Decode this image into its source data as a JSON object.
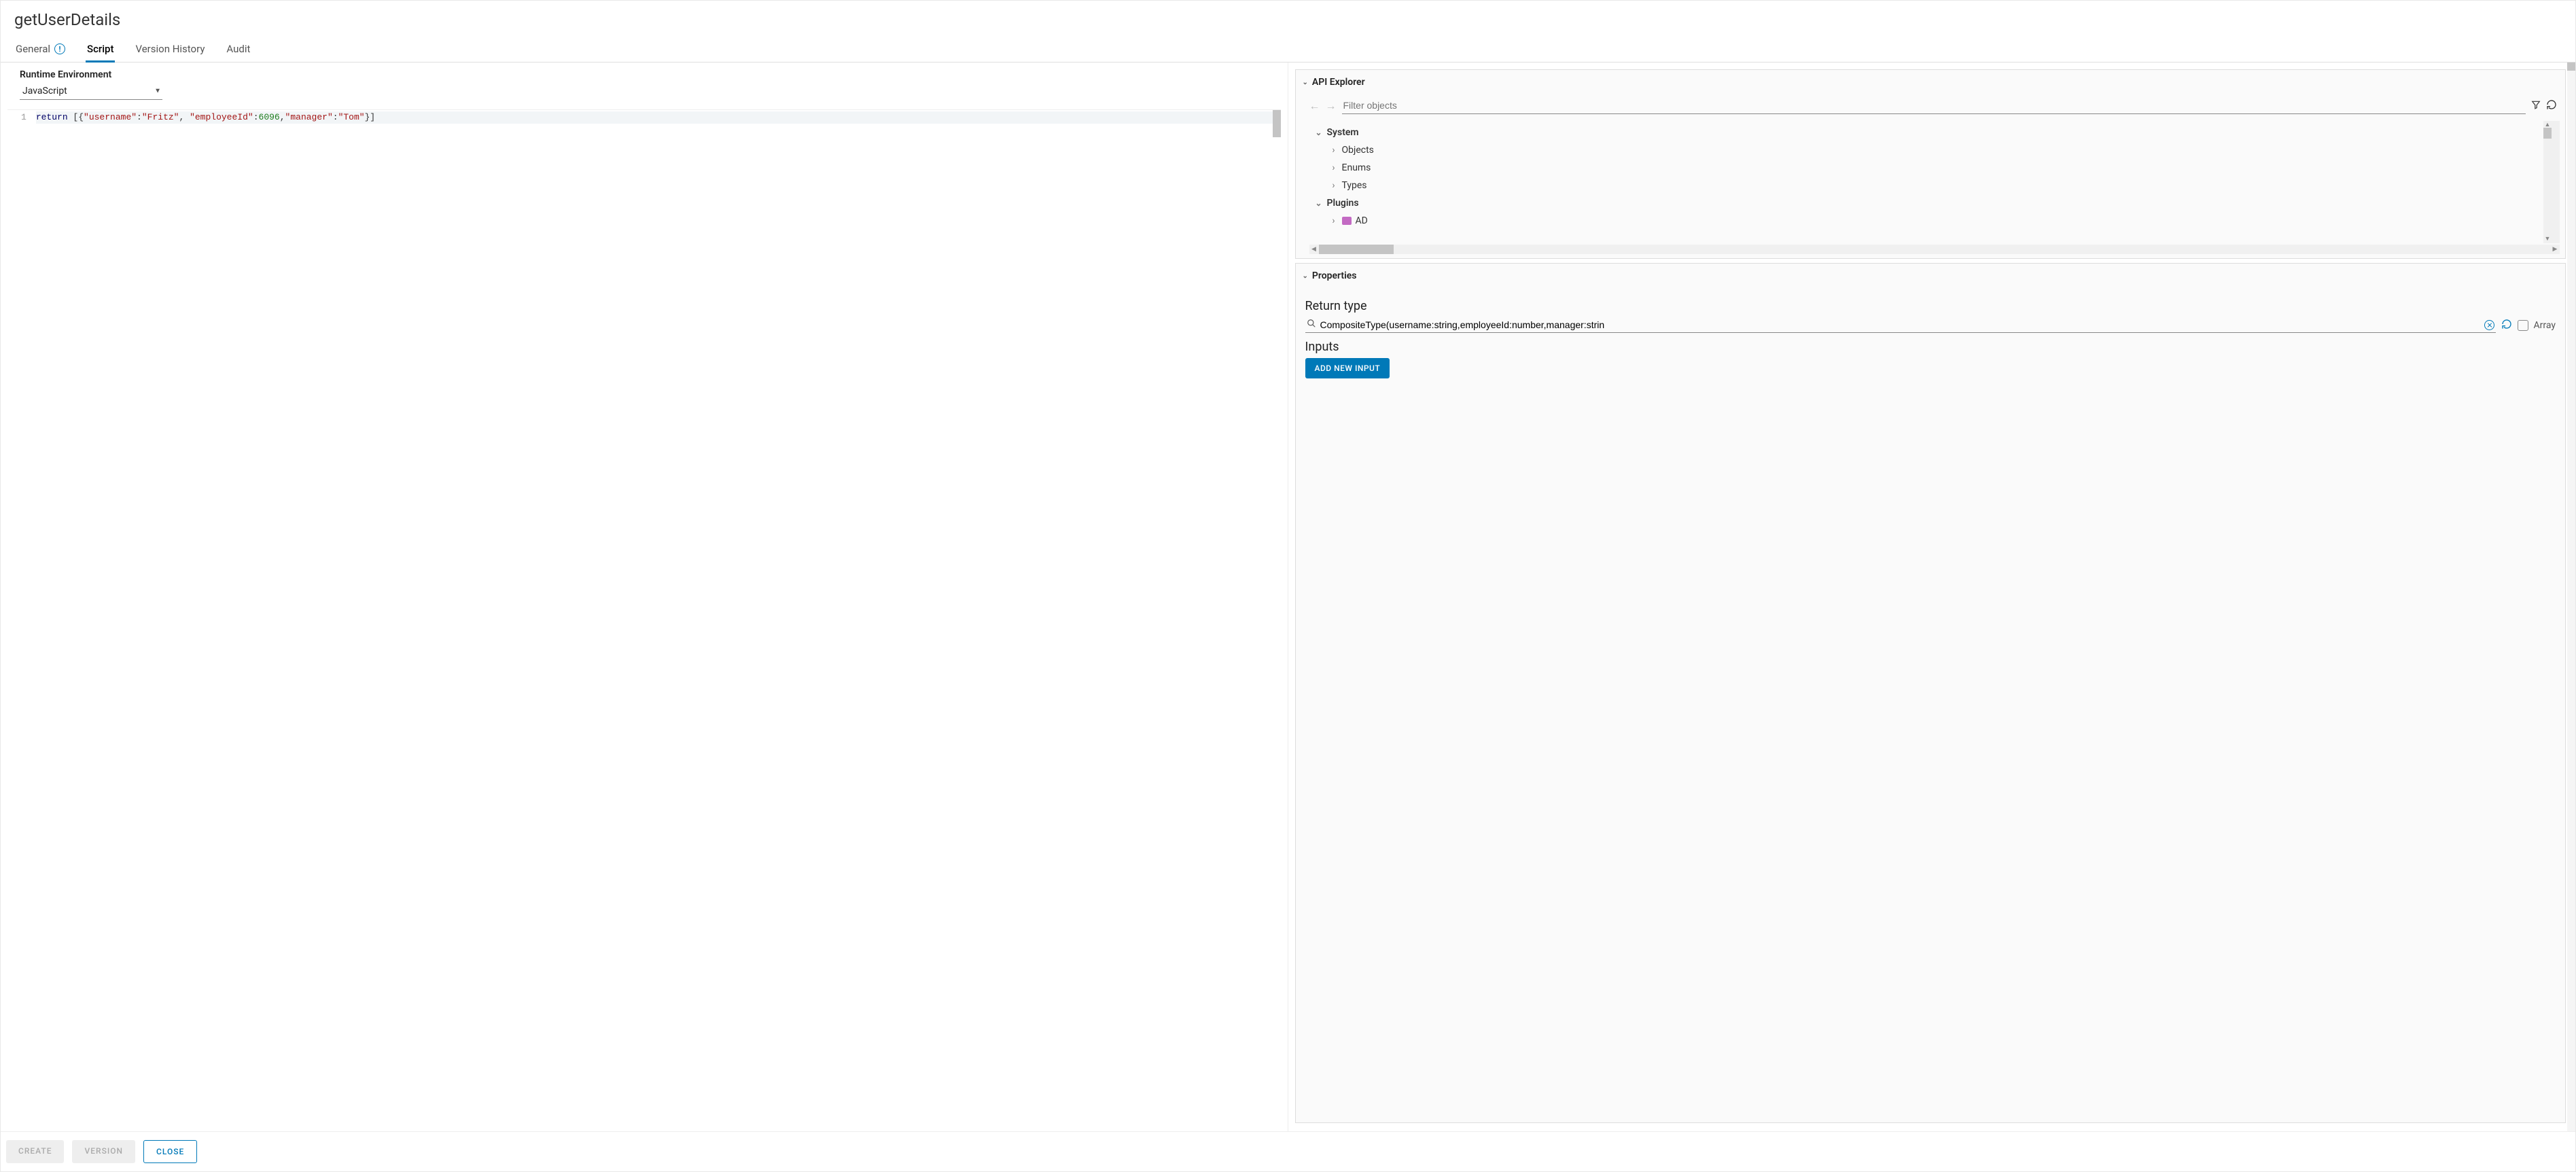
{
  "header": {
    "title": "getUserDetails"
  },
  "tabs": [
    {
      "id": "general",
      "label": "General",
      "has_info": true
    },
    {
      "id": "script",
      "label": "Script",
      "active": true
    },
    {
      "id": "version",
      "label": "Version History"
    },
    {
      "id": "audit",
      "label": "Audit"
    }
  ],
  "runtime": {
    "label": "Runtime Environment",
    "selected": "JavaScript"
  },
  "editor": {
    "lines": [
      {
        "n": 1,
        "tokens": [
          {
            "t": "kw",
            "v": "return"
          },
          {
            "t": "",
            "v": " [{"
          },
          {
            "t": "str",
            "v": "\"username\""
          },
          {
            "t": "",
            "v": ":"
          },
          {
            "t": "str",
            "v": "\"Fritz\""
          },
          {
            "t": "",
            "v": ", "
          },
          {
            "t": "str",
            "v": "\"employeeId\""
          },
          {
            "t": "",
            "v": ":"
          },
          {
            "t": "num",
            "v": "6096"
          },
          {
            "t": "",
            "v": ","
          },
          {
            "t": "str",
            "v": "\"manager\""
          },
          {
            "t": "",
            "v": ":"
          },
          {
            "t": "str",
            "v": "\"Tom\""
          },
          {
            "t": "",
            "v": "}]"
          }
        ]
      }
    ]
  },
  "api_explorer": {
    "title": "API Explorer",
    "filter_placeholder": "Filter objects",
    "tree": [
      {
        "label": "System",
        "expanded": true,
        "level": 1,
        "bold": true
      },
      {
        "label": "Objects",
        "expanded": false,
        "level": 2
      },
      {
        "label": "Enums",
        "expanded": false,
        "level": 2
      },
      {
        "label": "Types",
        "expanded": false,
        "level": 2
      },
      {
        "label": "Plugins",
        "expanded": true,
        "level": 1,
        "bold": true
      },
      {
        "label": "AD",
        "expanded": false,
        "level": 2,
        "icon": "plugin"
      }
    ]
  },
  "properties": {
    "title": "Properties",
    "return_type_label": "Return type",
    "return_type_value": "CompositeType(username:string,employeeId:number,manager:strin",
    "array_label": "Array",
    "inputs_label": "Inputs",
    "add_input_label": "Add New Input"
  },
  "footer": {
    "create": "Create",
    "version": "Version",
    "close": "Close"
  }
}
